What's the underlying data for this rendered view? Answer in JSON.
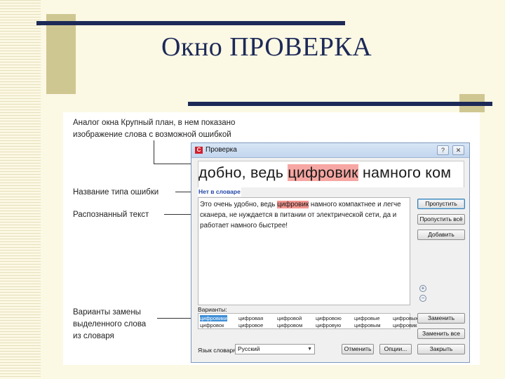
{
  "slide": {
    "title": "Окно ПРОВЕРКА"
  },
  "annotations": {
    "zoom_desc_line1": "Аналог окна Крупный план, в нем показано",
    "zoom_desc_line2": "изображение слова с возможной ошибкой",
    "error_type": "Название типа ошибки",
    "recognized_text": "Распознанный текст",
    "variants_line1": "Варианты замены",
    "variants_line2": "выделенного слова",
    "variants_line3": "из словаря"
  },
  "dialog": {
    "title": "Проверка",
    "help_button": "?",
    "close_button": "✕",
    "zoom": {
      "before": "добно, ведь ",
      "highlight": "цифровик",
      "after": " намного ком"
    },
    "error_type": "Нет в словаре",
    "text": {
      "part1": "Это очень удобно, ведь ",
      "highlight": "цифровик",
      "part2": " намного компактнее и легче сканера, не нуждается в питании от электрической сети, да и работает намного быстрее!"
    },
    "buttons": {
      "skip": "Пропустить",
      "skip_all": "Пропустить всё",
      "add": "Добавить",
      "replace": "Заменить",
      "replace_all": "Заменить все",
      "undo": "Отменить",
      "options": "Опции...",
      "close": "Закрыть"
    },
    "variants_label": "Варианты:",
    "variants": [
      "цифровики",
      "цифровок",
      "цифровая",
      "цифровое",
      "цифровой",
      "цифровом",
      "цифровою",
      "цифровую",
      "цифровые",
      "цифровым",
      "цифровых",
      "цифровик"
    ],
    "language_label": "Язык словаря:",
    "language_value": "Русский"
  },
  "colors": {
    "accent_navy": "#1d2a57",
    "error_highlight": "#f3958f",
    "selection_blue": "#3e8fd8"
  }
}
